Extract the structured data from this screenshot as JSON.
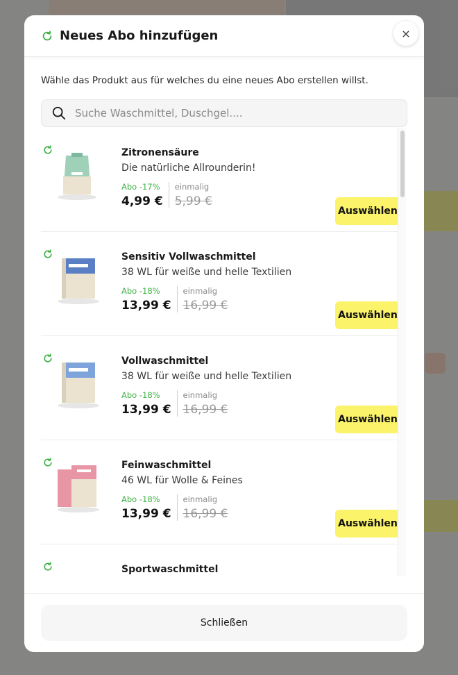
{
  "modal": {
    "title": "Neues Abo hinzufügen",
    "close_icon": "×",
    "intro": "Wähle das Produkt aus für welches du eine neues Abo erstellen willst.",
    "search_placeholder": "Suche Waschmittel, Duschgel....",
    "select_label": "Auswählen",
    "footer_button": "Schließen"
  },
  "products": [
    {
      "name": "Zitronensäure",
      "description": "Die natürliche Allrounderin!",
      "abo_label": "Abo -17%",
      "abo_price": "4,99 €",
      "once_label": "einmalig",
      "once_price": "5,99 €",
      "image_color": "#9fd0b8"
    },
    {
      "name": "Sensitiv Vollwaschmittel",
      "description": "38 WL für weiße und helle Textilien",
      "abo_label": "Abo -18%",
      "abo_price": "13,99 €",
      "once_label": "einmalig",
      "once_price": "16,99 €",
      "image_color": "#5a7fc4"
    },
    {
      "name": "Vollwaschmittel",
      "description": "38 WL für weiße und helle Textilien",
      "abo_label": "Abo -18%",
      "abo_price": "13,99 €",
      "once_label": "einmalig",
      "once_price": "16,99 €",
      "image_color": "#7fa4dc"
    },
    {
      "name": "Feinwaschmittel",
      "description": "46 WL für Wolle & Feines",
      "abo_label": "Abo -18%",
      "abo_price": "13,99 €",
      "once_label": "einmalig",
      "once_price": "16,99 €",
      "image_color": "#e895a6"
    },
    {
      "name": "Sportwaschmittel",
      "description": "",
      "abo_label": "",
      "abo_price": "",
      "once_label": "",
      "once_price": "",
      "image_color": ""
    }
  ],
  "colors": {
    "accent_green": "#3cb043",
    "select_button": "#fbf36a"
  }
}
